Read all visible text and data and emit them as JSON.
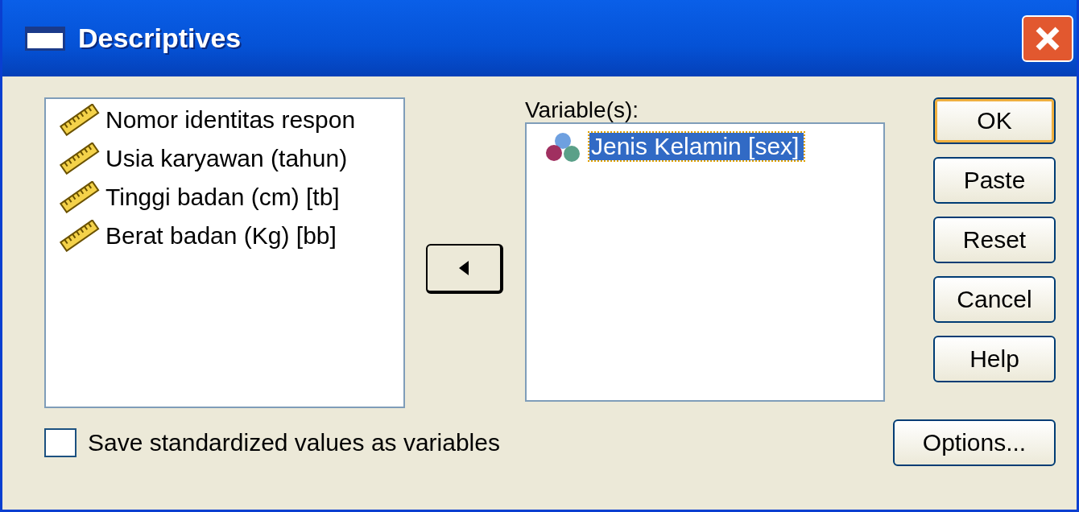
{
  "window": {
    "title": "Descriptives"
  },
  "source_list": {
    "items": [
      {
        "label": "Nomor identitas respon",
        "kind": "scale",
        "selected": false
      },
      {
        "label": "Usia karyawan (tahun)",
        "kind": "scale",
        "selected": false
      },
      {
        "label": "Tinggi badan (cm) [tb]",
        "kind": "scale",
        "selected": false
      },
      {
        "label": "Berat badan (Kg) [bb]",
        "kind": "scale",
        "selected": false
      }
    ]
  },
  "target_list": {
    "label": "Variable(s):",
    "items": [
      {
        "label": "Jenis Kelamin [sex]",
        "kind": "nominal",
        "selected": true
      }
    ]
  },
  "buttons": [
    {
      "label": "OK",
      "default": true
    },
    {
      "label": "Paste",
      "default": false
    },
    {
      "label": "Reset",
      "default": false
    },
    {
      "label": "Cancel",
      "default": false
    },
    {
      "label": "Help",
      "default": false
    }
  ],
  "save_checkbox": {
    "label": "Save standardized values as variables",
    "checked": false
  },
  "options_button": {
    "label": "Options..."
  }
}
